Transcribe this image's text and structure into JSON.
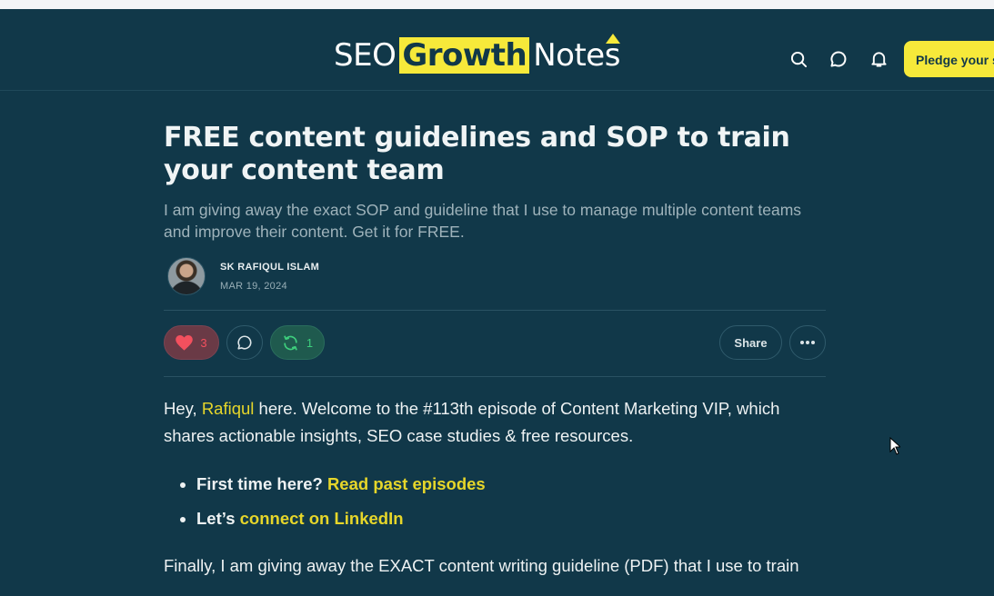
{
  "header": {
    "logo": {
      "word1": "SEO",
      "word2": "Growth",
      "word3": "Notes"
    },
    "search_icon": "search-icon",
    "chat_icon": "chat-bubble-icon",
    "bell_icon": "bell-icon",
    "pledge_label": "Pledge your s"
  },
  "article": {
    "title": "FREE content guidelines and SOP to train your content team",
    "subtitle": "I am giving away the exact SOP and guideline that I use to manage multiple content teams and improve their content. Get it for FREE.",
    "author": "SK RAFIQUL ISLAM",
    "date": "MAR 19, 2024",
    "likes": "3",
    "restacks": "1",
    "share_label": "Share",
    "intro_prefix": "Hey, ",
    "intro_link": "Rafiqul",
    "intro_suffix": " here. Welcome to the #113th episode of Content Marketing VIP, which shares actionable insights, SEO case studies & free resources.",
    "bullets": [
      {
        "prefix": "First time here? ",
        "link": "Read past episodes"
      },
      {
        "prefix": "Let’s ",
        "link": "connect on LinkedIn"
      }
    ],
    "next_paragraph": "Finally, I am giving away the EXACT content writing guideline (PDF) that I use to train"
  },
  "colors": {
    "background": "#113849",
    "accent_yellow": "#f6e93a",
    "link_yellow": "#e6d62a",
    "like_red": "#f3505e",
    "restack_green": "#3ecf7d"
  }
}
